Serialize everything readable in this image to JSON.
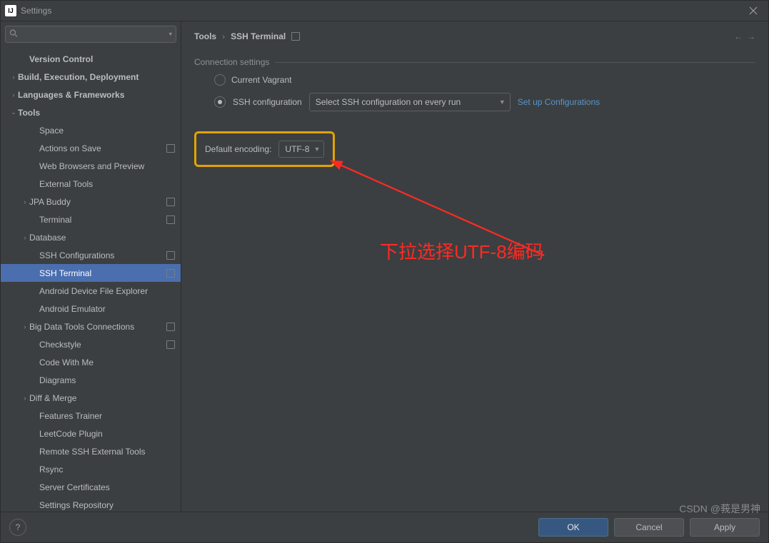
{
  "window": {
    "title": "Settings",
    "app_icon_text": "IJ"
  },
  "search": {
    "placeholder": ""
  },
  "sidebar": {
    "items": [
      {
        "label": "Version Control",
        "level": 1,
        "bold": true,
        "arrow": "",
        "badge": false
      },
      {
        "label": "Build, Execution, Deployment",
        "level": 0,
        "bold": true,
        "arrow": "›",
        "badge": false
      },
      {
        "label": "Languages & Frameworks",
        "level": 0,
        "bold": true,
        "arrow": "›",
        "badge": false
      },
      {
        "label": "Tools",
        "level": 0,
        "bold": true,
        "arrow": "⌄",
        "badge": false
      },
      {
        "label": "Space",
        "level": 2,
        "bold": false,
        "arrow": "",
        "badge": false
      },
      {
        "label": "Actions on Save",
        "level": 2,
        "bold": false,
        "arrow": "",
        "badge": true
      },
      {
        "label": "Web Browsers and Preview",
        "level": 2,
        "bold": false,
        "arrow": "",
        "badge": false
      },
      {
        "label": "External Tools",
        "level": 2,
        "bold": false,
        "arrow": "",
        "badge": false
      },
      {
        "label": "JPA Buddy",
        "level": 1,
        "bold": false,
        "arrow": "›",
        "badge": true
      },
      {
        "label": "Terminal",
        "level": 2,
        "bold": false,
        "arrow": "",
        "badge": true
      },
      {
        "label": "Database",
        "level": 1,
        "bold": false,
        "arrow": "›",
        "badge": false
      },
      {
        "label": "SSH Configurations",
        "level": 2,
        "bold": false,
        "arrow": "",
        "badge": true
      },
      {
        "label": "SSH Terminal",
        "level": 2,
        "bold": false,
        "arrow": "",
        "badge": true,
        "selected": true
      },
      {
        "label": "Android Device File Explorer",
        "level": 2,
        "bold": false,
        "arrow": "",
        "badge": false
      },
      {
        "label": "Android Emulator",
        "level": 2,
        "bold": false,
        "arrow": "",
        "badge": false
      },
      {
        "label": "Big Data Tools Connections",
        "level": 1,
        "bold": false,
        "arrow": "›",
        "badge": true
      },
      {
        "label": "Checkstyle",
        "level": 2,
        "bold": false,
        "arrow": "",
        "badge": true
      },
      {
        "label": "Code With Me",
        "level": 2,
        "bold": false,
        "arrow": "",
        "badge": false
      },
      {
        "label": "Diagrams",
        "level": 2,
        "bold": false,
        "arrow": "",
        "badge": false
      },
      {
        "label": "Diff & Merge",
        "level": 1,
        "bold": false,
        "arrow": "›",
        "badge": false
      },
      {
        "label": "Features Trainer",
        "level": 2,
        "bold": false,
        "arrow": "",
        "badge": false
      },
      {
        "label": "LeetCode Plugin",
        "level": 2,
        "bold": false,
        "arrow": "",
        "badge": false
      },
      {
        "label": "Remote SSH External Tools",
        "level": 2,
        "bold": false,
        "arrow": "",
        "badge": false
      },
      {
        "label": "Rsync",
        "level": 2,
        "bold": false,
        "arrow": "",
        "badge": false
      },
      {
        "label": "Server Certificates",
        "level": 2,
        "bold": false,
        "arrow": "",
        "badge": false
      },
      {
        "label": "Settings Repository",
        "level": 2,
        "bold": false,
        "arrow": "",
        "badge": false
      }
    ]
  },
  "breadcrumb": {
    "root": "Tools",
    "leaf": "SSH Terminal"
  },
  "section": {
    "title": "Connection settings",
    "radio_vagrant": "Current Vagrant",
    "radio_ssh": "SSH configuration",
    "ssh_select": "Select SSH configuration on every run",
    "setup_link": "Set up Configurations"
  },
  "encoding": {
    "label": "Default encoding:",
    "value": "UTF-8"
  },
  "annotation": {
    "text": "下拉选择UTF-8编码"
  },
  "footer": {
    "ok": "OK",
    "cancel": "Cancel",
    "apply": "Apply"
  },
  "watermark": "CSDN @莪是男神"
}
